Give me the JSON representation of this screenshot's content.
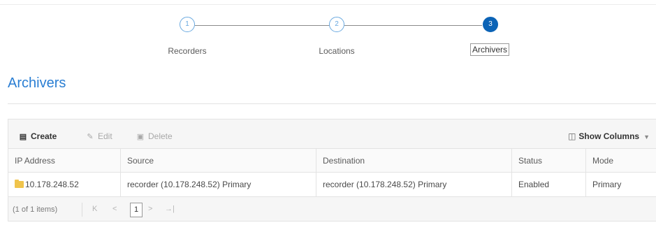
{
  "wizard": {
    "steps": [
      {
        "number": "1",
        "label": "Recorders"
      },
      {
        "number": "2",
        "label": "Locations"
      },
      {
        "number": "3",
        "label": "Archivers"
      }
    ],
    "active_step": 3
  },
  "page": {
    "title": "Archivers"
  },
  "toolbar": {
    "create_label": "Create",
    "edit_label": "Edit",
    "delete_label": "Delete",
    "show_columns_label": "Show Columns"
  },
  "table": {
    "columns": [
      "IP Address",
      "Source",
      "Destination",
      "Status",
      "Mode"
    ],
    "rows": [
      {
        "ip_address": "10.178.248.52",
        "source": "recorder (10.178.248.52) Primary",
        "destination": "recorder (10.178.248.52) Primary",
        "status": "Enabled",
        "mode": "Primary"
      }
    ]
  },
  "pager": {
    "info": "(1 of 1 items)",
    "current_page": "1"
  },
  "colors": {
    "accent": "#2a7ed3",
    "active_step": "#0b63b6",
    "step_outline": "#6aa9e0"
  }
}
